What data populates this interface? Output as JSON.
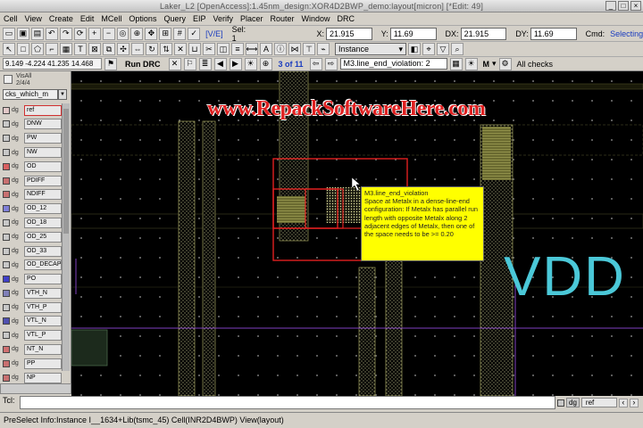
{
  "window": {
    "title": "Laker_L2 [OpenAccess]:1.45nm_design:XOR4D2BWP_demo:layout[micron] [*Edit: 49]"
  },
  "menu": [
    "Cell",
    "View",
    "Create",
    "Edit",
    "MCell",
    "Options",
    "Query",
    "EIP",
    "Verify",
    "Placer",
    "Router",
    "Window",
    "DRC"
  ],
  "toolbar1": {
    "ve_label": "[V/E]",
    "sel_label": "Sel: 1",
    "x_label": "X:",
    "x_value": "21.915",
    "y_label": "Y:",
    "y_value": "11.69",
    "dx_label": "DX:",
    "dx_value": "21.915",
    "dy_label": "DY:",
    "dy_value": "11.69",
    "cmd_label": "Cmd:",
    "cmd_value": "Selecting"
  },
  "toolbar2": {
    "instance_label": "Instance"
  },
  "toolbar3": {
    "coords": "9.149 -4.224 41.235 14.468",
    "run_drc": "Run DRC",
    "counter": "3 of 11",
    "violation": "M3.line_end_violation: 2",
    "layer": "M",
    "checks": "All checks"
  },
  "panel": {
    "visall": "VisAll",
    "visall_sub": "2/4/4",
    "filter": "cks_which_m",
    "layers": [
      {
        "dg": "dg",
        "name": "ref",
        "color": "#e2c8c8",
        "selected": true
      },
      {
        "dg": "dg",
        "name": "DNW",
        "color": "#c8c8c8"
      },
      {
        "dg": "dg",
        "name": "PW",
        "color": "#c8c8c8"
      },
      {
        "dg": "dg",
        "name": "NW",
        "color": "#c8c8c8"
      },
      {
        "dg": "dg",
        "name": "OD",
        "color": "#d86060"
      },
      {
        "dg": "dg",
        "name": "PDIFF",
        "color": "#c87070"
      },
      {
        "dg": "dg",
        "name": "NDIFF",
        "color": "#c87070"
      },
      {
        "dg": "dg",
        "name": "OD_12",
        "color": "#8080d8"
      },
      {
        "dg": "dg",
        "name": "OD_18",
        "color": "#c8c8c8"
      },
      {
        "dg": "dg",
        "name": "OD_25",
        "color": "#c8c8c8"
      },
      {
        "dg": "dg",
        "name": "OD_33",
        "color": "#c8c8c8"
      },
      {
        "dg": "dg",
        "name": "OD_DECAP",
        "color": "#c8c8c8"
      },
      {
        "dg": "dg",
        "name": "PO",
        "color": "#4040c8"
      },
      {
        "dg": "dg",
        "name": "VTH_N",
        "color": "#8080b8"
      },
      {
        "dg": "dg",
        "name": "VTH_P",
        "color": "#c8c8c8"
      },
      {
        "dg": "dg",
        "name": "VTL_N",
        "color": "#5050b0"
      },
      {
        "dg": "dg",
        "name": "VTL_P",
        "color": "#c8c8c8"
      },
      {
        "dg": "dg",
        "name": "NT_N",
        "color": "#d07070"
      },
      {
        "dg": "dg",
        "name": "PP",
        "color": "#c87070"
      },
      {
        "dg": "dg",
        "name": "NP",
        "color": "#c87070"
      }
    ]
  },
  "canvas": {
    "watermark": "www.RepackSoftwareHere.com",
    "tooltip_title": "M3.line_end_violation",
    "tooltip_body": "Space at Metalx in a dense-line-end configuration: If Metalx has parallel run length with opposite Metalx along 2 adjacent edges of Metalx, then one of the space needs to be >= 0.20",
    "pin_label": "VDD"
  },
  "bottom": {
    "tcl_label": "Tcl:",
    "dg": "dg",
    "ref": "ref"
  },
  "status": {
    "text": "PreSelect Info:Instance I__1634+Lib(tsmc_45) Cell(INR2D4BWP) View(layout)"
  }
}
